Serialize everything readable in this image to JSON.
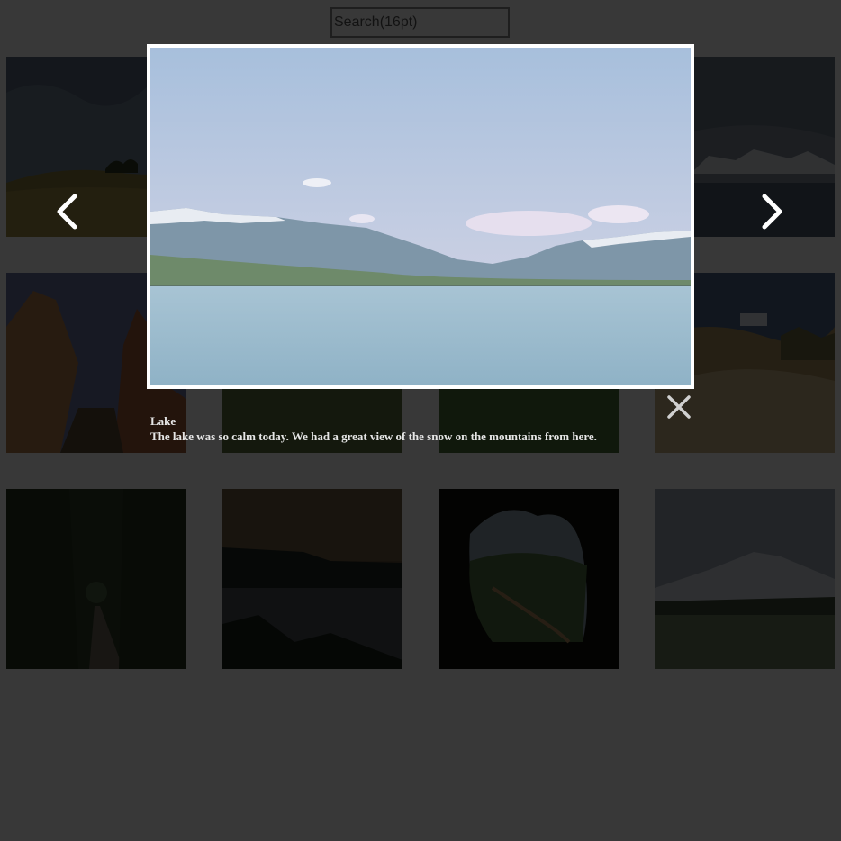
{
  "search": {
    "placeholder": "Search(16pt)",
    "value": ""
  },
  "gallery": {
    "items": [
      {
        "name": "thumbnail-meadow-hill"
      },
      {
        "name": "thumbnail-lake"
      },
      {
        "name": "thumbnail-forest-river"
      },
      {
        "name": "thumbnail-glacier-icebergs"
      },
      {
        "name": "thumbnail-red-rock-canyon"
      },
      {
        "name": "thumbnail-dark-meadow"
      },
      {
        "name": "thumbnail-green-field"
      },
      {
        "name": "thumbnail-sand-dunes"
      },
      {
        "name": "thumbnail-forest-path"
      },
      {
        "name": "thumbnail-coastal-cliffs"
      },
      {
        "name": "thumbnail-cave-view"
      },
      {
        "name": "thumbnail-snowy-mountain-field"
      }
    ]
  },
  "lightbox": {
    "title": "Lake",
    "description": "The lake was so calm today. We had a great view of the snow on the mountains from here.",
    "prev_icon": "chevron-left-icon",
    "next_icon": "chevron-right-icon",
    "close_icon": "close-icon"
  },
  "colors": {
    "overlay": "#000000",
    "lightbox_border": "#ffffff",
    "caption_text": "#e6e6e6",
    "icon": "#ffffff",
    "close_icon": "#d0d0d0"
  }
}
